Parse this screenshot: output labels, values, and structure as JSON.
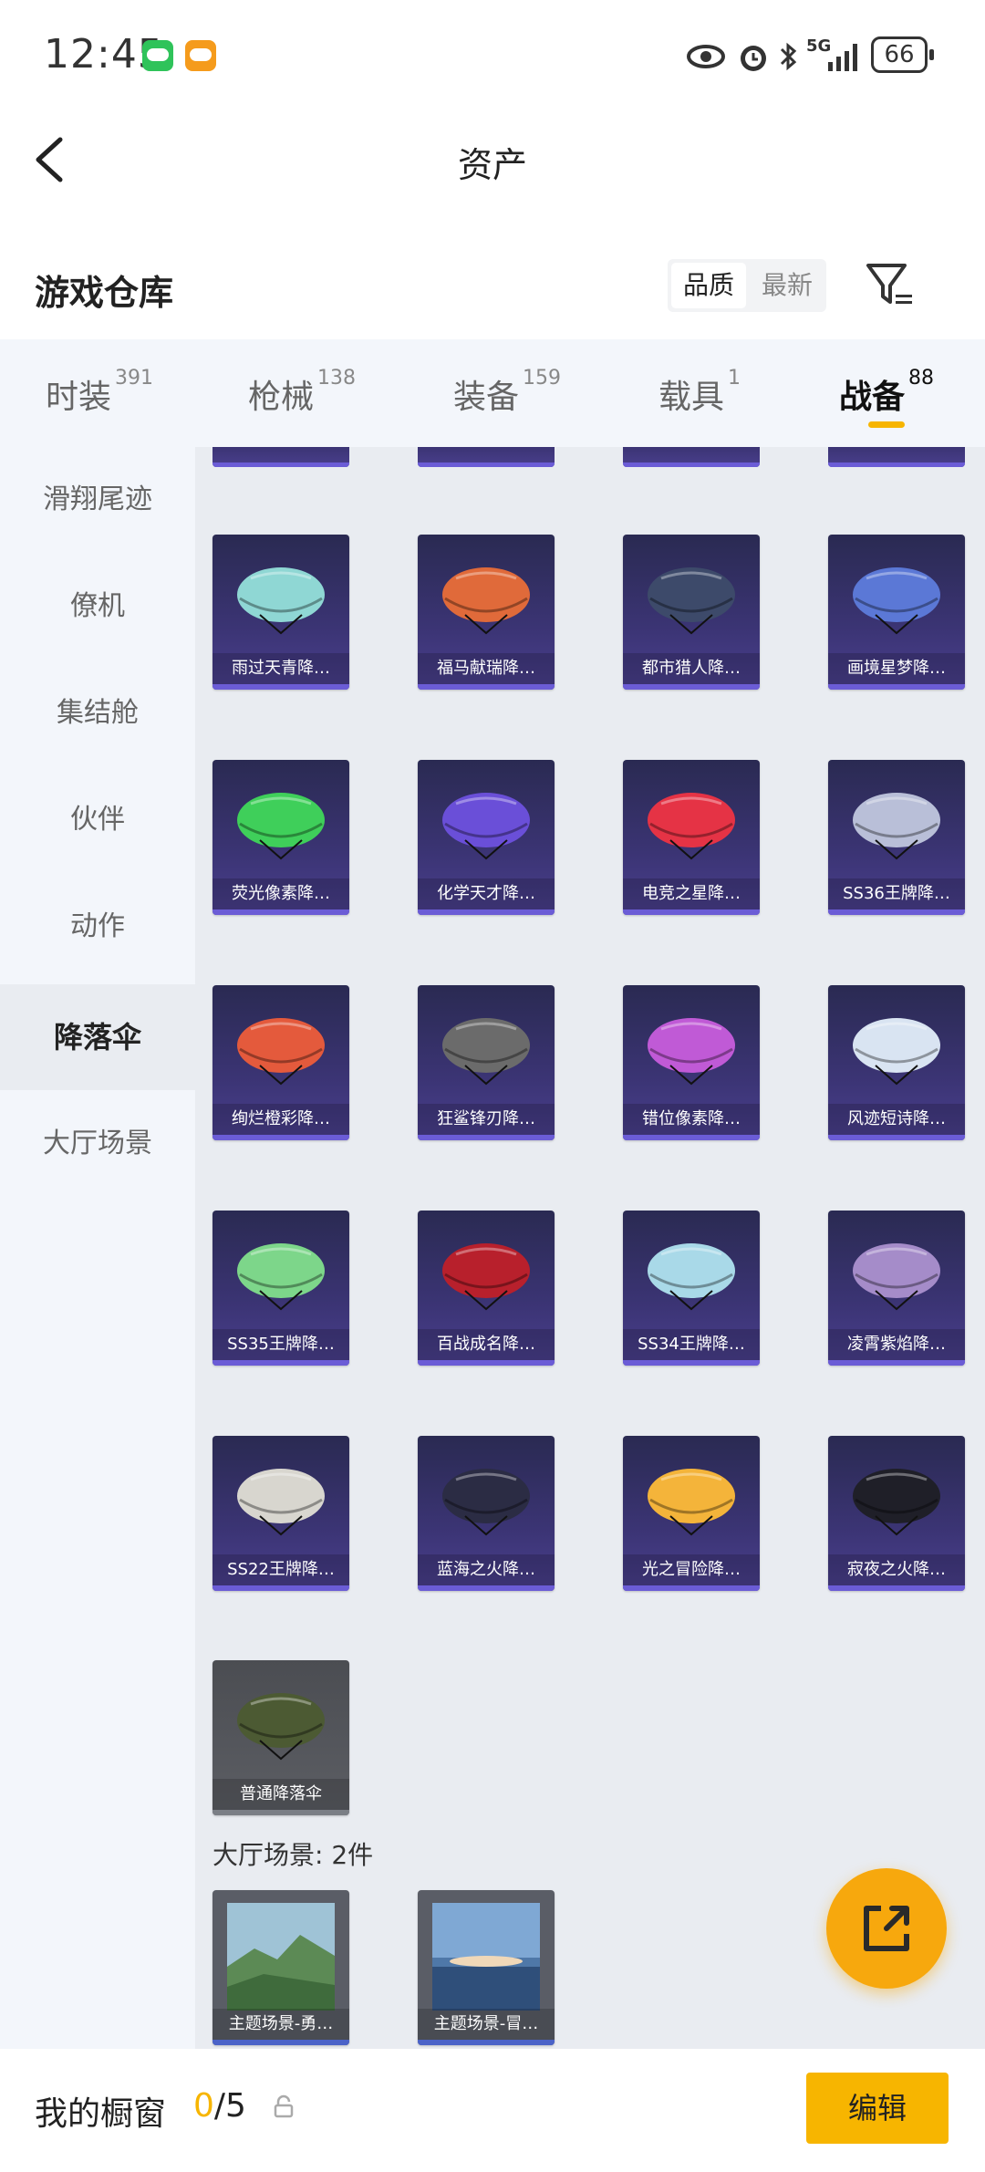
{
  "status_bar": {
    "time": "12:45",
    "battery": "66",
    "network": "5G"
  },
  "header": {
    "title": "资产"
  },
  "section": {
    "title": "游戏仓库",
    "sort_options": [
      "品质",
      "最新"
    ],
    "active_sort": "品质"
  },
  "tabs": [
    {
      "label": "时装",
      "count": "391"
    },
    {
      "label": "枪械",
      "count": "138"
    },
    {
      "label": "装备",
      "count": "159"
    },
    {
      "label": "载具",
      "count": "1"
    },
    {
      "label": "战备",
      "count": "88"
    }
  ],
  "active_tab": "战备",
  "sidebar": {
    "items": [
      "滑翔尾迹",
      "僚机",
      "集结舱",
      "伙伴",
      "动作",
      "降落伞",
      "大厅场景"
    ],
    "active": "降落伞"
  },
  "parachutes": [
    {
      "name": "雨过天青降…",
      "color": "#8fd7d4"
    },
    {
      "name": "福马献瑞降…",
      "color": "#e06a3a"
    },
    {
      "name": "都市猎人降…",
      "color": "#3d4a6a"
    },
    {
      "name": "画境星梦降…",
      "color": "#5b78d6"
    },
    {
      "name": "荧光像素降…",
      "color": "#3fcf5a"
    },
    {
      "name": "化学天才降…",
      "color": "#6a4fd8"
    },
    {
      "name": "电竞之星降…",
      "color": "#e53345"
    },
    {
      "name": "SS36王牌降…",
      "color": "#b9bfd8"
    },
    {
      "name": "绚烂橙彩降…",
      "color": "#e45a3c"
    },
    {
      "name": "狂鲨锋刃降…",
      "color": "#6b6b6b"
    },
    {
      "name": "错位像素降…",
      "color": "#c05ad6"
    },
    {
      "name": "风迹短诗降…",
      "color": "#d9e4f2"
    },
    {
      "name": "SS35王牌降…",
      "color": "#7dd68a"
    },
    {
      "name": "百战成名降…",
      "color": "#b8202c"
    },
    {
      "name": "SS34王牌降…",
      "color": "#a9d9e8"
    },
    {
      "name": "凌霄紫焰降…",
      "color": "#a58cc9"
    },
    {
      "name": "SS22王牌降…",
      "color": "#d8d6cf"
    },
    {
      "name": "蓝海之火降…",
      "color": "#2b2c44"
    },
    {
      "name": "光之冒险降…",
      "color": "#f4b43a"
    },
    {
      "name": "寂夜之火降…",
      "color": "#1f1f28"
    },
    {
      "name": "普通降落伞",
      "color": "#4c5a33",
      "grey": true
    }
  ],
  "scene_group": {
    "label": "大厅场景: 2件"
  },
  "scenes": [
    {
      "name": "主题场景-勇…",
      "color": "#6f9a6a"
    },
    {
      "name": "主题场景-冒…",
      "color": "#5f86b3"
    }
  ],
  "bottom": {
    "showcase_label": "我的橱窗",
    "current": "0",
    "separator": "/",
    "max": "5",
    "edit_label": "编辑"
  },
  "colors": {
    "accent": "#f7b500",
    "card_bg": "#3b3474",
    "sidebar_bg": "#f3f6fb"
  }
}
